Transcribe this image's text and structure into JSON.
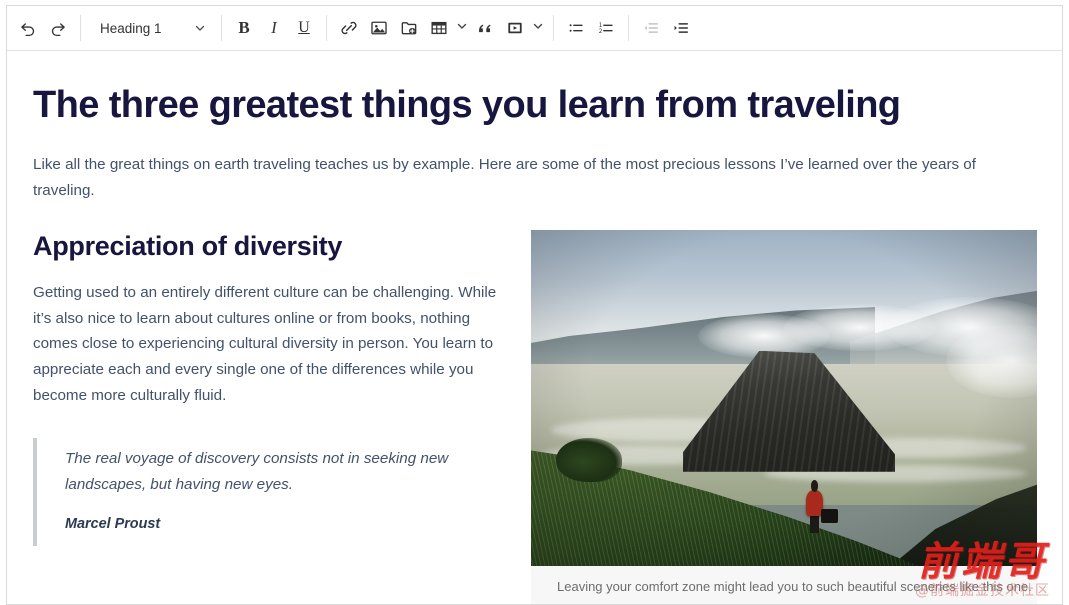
{
  "editor": {
    "toolbar": {
      "undo_label": "Undo",
      "redo_label": "Redo",
      "heading_select_value": "Heading 1",
      "bold_label": "B",
      "italic_label": "I",
      "underline_label": "U",
      "link_label": "Link",
      "image_label": "Image",
      "insert_image_label": "Insert image",
      "table_label": "Insert table",
      "blockquote_label": "Block quote",
      "media_label": "Insert media",
      "bulleted_list_label": "Bulleted list",
      "numbered_list_label": "Numbered list",
      "outdent_label": "Decrease indent",
      "indent_label": "Increase indent",
      "icons": {
        "undo": "undo-icon",
        "redo": "redo-icon",
        "heading_caret": "chevron-down-icon",
        "bold": "bold-icon",
        "italic": "italic-icon",
        "underline": "underline-icon",
        "link": "link-icon",
        "image": "image-icon",
        "insert_image": "insert-image-icon",
        "table": "table-icon",
        "table_caret": "chevron-down-icon",
        "blockquote": "quote-icon",
        "media": "media-icon",
        "media_caret": "chevron-down-icon",
        "bulleted_list": "bulleted-list-icon",
        "numbered_list": "numbered-list-icon",
        "outdent": "outdent-icon",
        "indent": "indent-icon"
      }
    },
    "document": {
      "title": "The three greatest things you learn from traveling",
      "intro": "Like all the great things on earth traveling teaches us by example. Here are some of the most precious lessons I’ve learned over the years of traveling.",
      "section_heading": "Appreciation of diversity",
      "section_paragraph": "Getting used to an entirely different culture can be challenging. While it’s also nice to learn about cultures online or from books, nothing comes close to experiencing cultural diversity in person. You learn to appreciate each and every single one of the differences while you become more culturally fluid.",
      "quote_text": "The real voyage of discovery consists not in seeking new landscapes, but having new eyes.",
      "quote_author": "Marcel Proust",
      "figure_caption": "Leaving your comfort zone might lead you to such beautiful sceneries like this one.",
      "figure_alt": "A lone hiker in a red jacket walking down a grassy slope overlooking a volcanic caldera with a smoking cone"
    },
    "watermark": {
      "main": "前端哥",
      "sub": "@前端掘金技术社区"
    },
    "colors": {
      "heading": "#16163f",
      "body_text": "#42526a",
      "caption_bg": "#f7f7f7",
      "caption_text": "#6d6d6d",
      "quote_bar": "#c9ccd2",
      "watermark": "#e0201b"
    }
  }
}
